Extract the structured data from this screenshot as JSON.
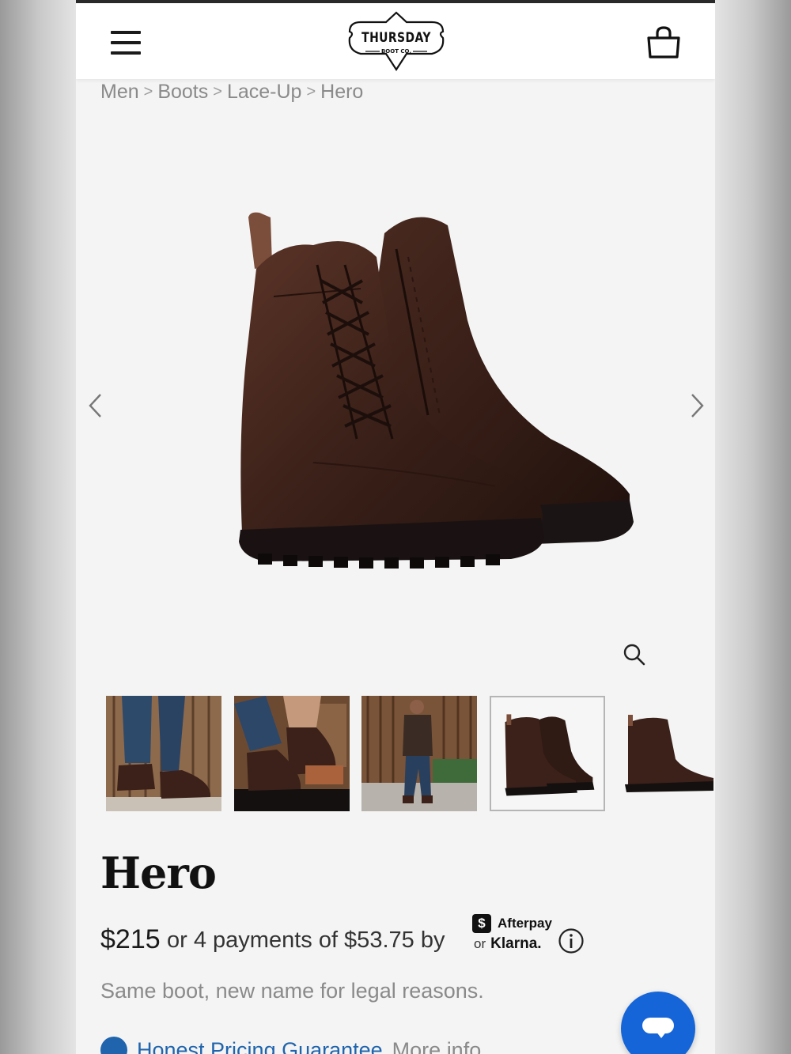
{
  "header": {
    "logo_text": "THURSDAY",
    "logo_subtext": "BOOT CO.",
    "menu_icon": "hamburger-menu-icon",
    "cart_icon": "shopping-bag-icon"
  },
  "breadcrumb": {
    "items": [
      "Men",
      "Boots",
      "Lace-Up",
      "Hero"
    ],
    "separator": ">"
  },
  "gallery": {
    "main_image_subject": "brown leather lace-up boots",
    "prev_icon": "chevron-left-icon",
    "next_icon": "chevron-right-icon",
    "zoom_icon": "magnifier-icon",
    "thumbnails": [
      {
        "subject": "boots worn with jeans on wooden backdrop",
        "active": false
      },
      {
        "subject": "man lacing boot on bench",
        "active": false
      },
      {
        "subject": "man walking outside wood wall",
        "active": false
      },
      {
        "subject": "pair of brown lace-up boots",
        "active": true
      },
      {
        "subject": "single boot side view",
        "active": false
      }
    ]
  },
  "product": {
    "title": "Hero",
    "price": "$215",
    "installments_text": "or 4 payments of $53.75 by",
    "afterpay_badge": "$",
    "afterpay_label": "Afterpay",
    "klarna_or": "or",
    "klarna_label": "Klarna.",
    "info_icon": "info-circle-icon",
    "tagline": "Same boot, new name for legal reasons.",
    "guarantee_link": "Honest Pricing Guarantee",
    "more_info_link": "More info"
  },
  "chat": {
    "icon": "chat-bubble-icon"
  },
  "colors": {
    "accent_blue": "#1f64ad",
    "chat_blue": "#1565d8",
    "boot_brown": "#3b2119"
  }
}
